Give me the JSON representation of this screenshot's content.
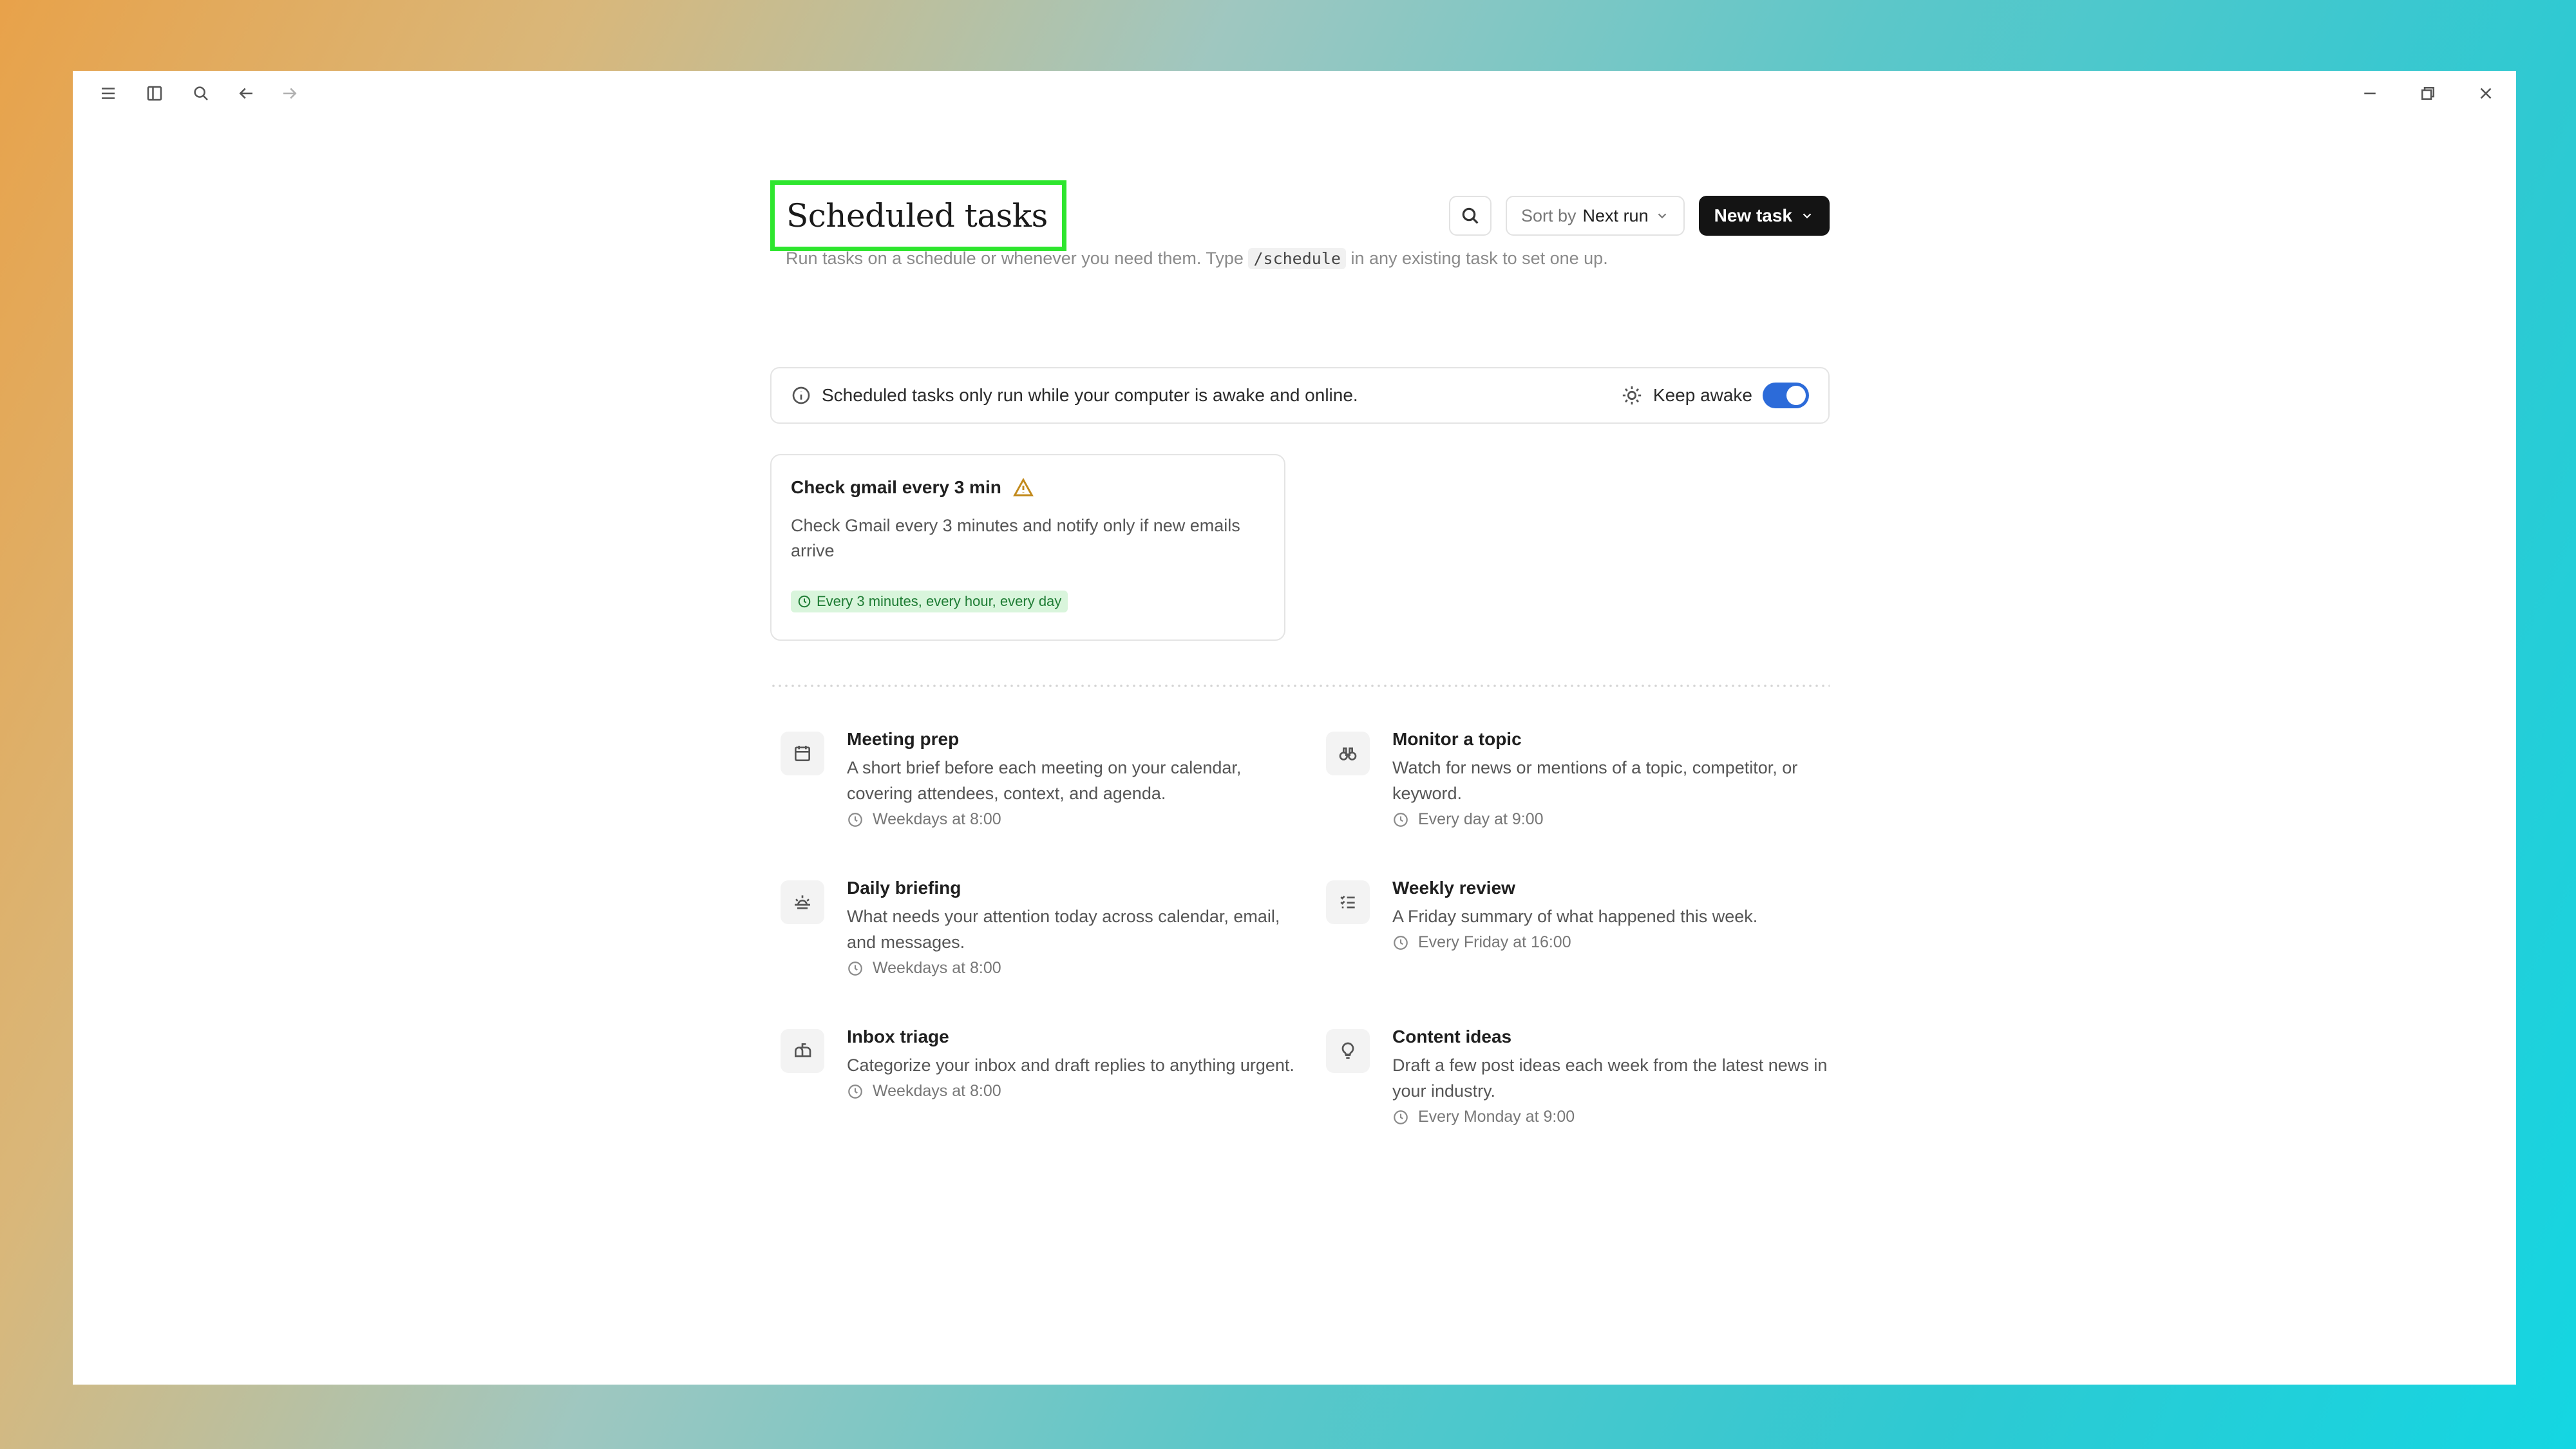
{
  "header": {
    "title": "Scheduled tasks",
    "subtitle_before": "Run tasks on a schedule or whenever you need them. Type",
    "subtitle_code": "/schedule",
    "subtitle_after": "in any existing task to set one up.",
    "sort_prefix": "Sort by",
    "sort_value": "Next run",
    "new_task_label": "New task"
  },
  "notice": {
    "text": "Scheduled tasks only run while your computer is awake and online.",
    "keep_awake_label": "Keep awake",
    "keep_awake_on": true
  },
  "task": {
    "title": "Check gmail every 3 min",
    "description": "Check Gmail every 3 minutes and notify only if new emails arrive",
    "schedule": "Every 3 minutes, every hour, every day"
  },
  "templates": [
    {
      "title": "Meeting prep",
      "description": "A short brief before each meeting on your calendar, covering attendees, context, and agenda.",
      "schedule": "Weekdays at 8:00",
      "icon": "calendar-icon"
    },
    {
      "title": "Monitor a topic",
      "description": "Watch for news or mentions of a topic, competitor, or keyword.",
      "schedule": "Every day at 9:00",
      "icon": "binoculars-icon"
    },
    {
      "title": "Daily briefing",
      "description": "What needs your attention today across calendar, email, and messages.",
      "schedule": "Weekdays at 8:00",
      "icon": "sunrise-icon"
    },
    {
      "title": "Weekly review",
      "description": "A Friday summary of what happened this week.",
      "schedule": "Every Friday at 16:00",
      "icon": "checklist-icon"
    },
    {
      "title": "Inbox triage",
      "description": "Categorize your inbox and draft replies to anything urgent.",
      "schedule": "Weekdays at 8:00",
      "icon": "mailbox-icon"
    },
    {
      "title": "Content ideas",
      "description": "Draft a few post ideas each week from the latest news in your industry.",
      "schedule": "Every Monday at 9:00",
      "icon": "lightbulb-icon"
    }
  ],
  "colors": {
    "highlight_border": "#2ee62e",
    "toggle_on": "#2c6bd9",
    "badge_bg": "#d9f5dc",
    "badge_text": "#1e7c34",
    "warning": "#c28a1c"
  }
}
